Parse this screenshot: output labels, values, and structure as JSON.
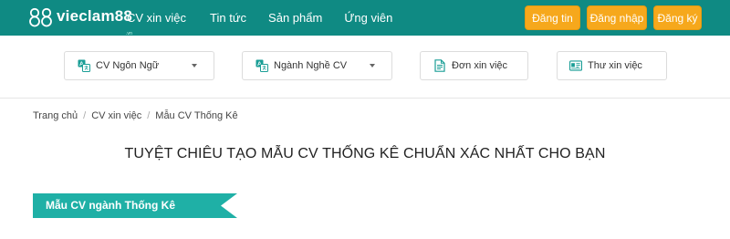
{
  "header": {
    "logo": {
      "brand": "vieclam88",
      "sub": ".vn"
    },
    "nav": [
      {
        "label": "CV xin việc"
      },
      {
        "label": "Tin tức"
      },
      {
        "label": "Sản phẩm"
      },
      {
        "label": "Ứng viên"
      }
    ],
    "actions": {
      "post_job": "Đăng tin",
      "login": "Đăng nhập",
      "register": "Đăng ký"
    }
  },
  "filters": {
    "language": {
      "label": "CV Ngôn Ngữ",
      "icon": "translate-icon"
    },
    "industry": {
      "label": "Ngành Nghề CV",
      "icon": "translate-icon"
    },
    "application": {
      "label": "Đơn xin việc",
      "icon": "document-icon"
    },
    "cover_letter": {
      "label": "Thư xin việc",
      "icon": "id-card-icon"
    }
  },
  "breadcrumb": [
    "Trang chủ",
    "CV xin việc",
    "Mẫu CV Thống Kê"
  ],
  "page_title": "TUYỆT CHIÊU TẠO MẪU CV THỐNG KÊ CHUẨN XÁC NHẤT CHO BẠN",
  "section": {
    "label": "Mẫu CV ngành Thống Kê"
  },
  "colors": {
    "header_bg": "#0f8a83",
    "accent_orange": "#f6a81c",
    "ribbon": "#1fb0a6",
    "icon_teal": "#1a9e96"
  }
}
